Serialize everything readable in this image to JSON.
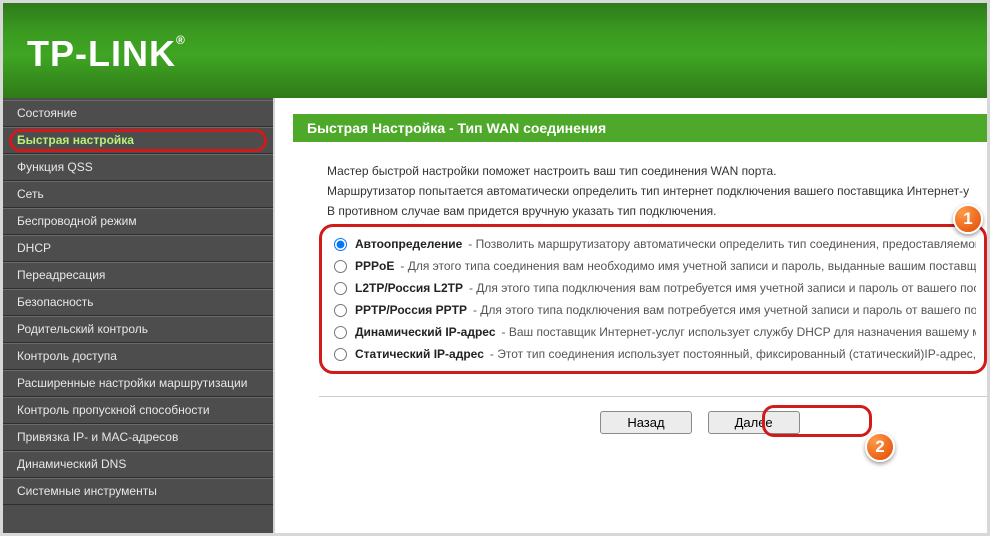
{
  "brand": "TP-LINK",
  "sidebar": {
    "items": [
      {
        "label": "Состояние"
      },
      {
        "label": "Быстрая настройка"
      },
      {
        "label": "Функция QSS"
      },
      {
        "label": "Сеть"
      },
      {
        "label": "Беспроводной режим"
      },
      {
        "label": "DHCP"
      },
      {
        "label": "Переадресация"
      },
      {
        "label": "Безопасность"
      },
      {
        "label": "Родительский контроль"
      },
      {
        "label": "Контроль доступа"
      },
      {
        "label": "Расширенные настройки маршрутизации"
      },
      {
        "label": "Контроль пропускной способности"
      },
      {
        "label": "Привязка IP- и MAC-адресов"
      },
      {
        "label": "Динамический DNS"
      },
      {
        "label": "Системные инструменты"
      }
    ]
  },
  "page": {
    "title": "Быстрая Настройка - Тип WAN соединения",
    "intro1": "Мастер быстрой настройки поможет настроить ваш тип соединения WAN порта.",
    "intro2": "Маршрутизатор попытается автоматически определить тип интернет подключения вашего поставщика Интернет-у",
    "intro3": "В противном случае вам придется вручную указать тип подключения.",
    "options": [
      {
        "label": "Автоопределение",
        "desc": " - Позволить маршрутизатору автоматически определить тип соединения, предоставляемого",
        "checked": true
      },
      {
        "label": "PPPoE",
        "desc": " - Для этого типа соединения вам необходимо имя учетной записи и пароль, выданные вашим поставщико",
        "checked": false
      },
      {
        "label": "L2TP/Россия L2TP",
        "desc": " - Для этого типа подключения вам потребуется имя учетной записи и пароль от вашего постав",
        "checked": false
      },
      {
        "label": "PPTP/Россия PPTP",
        "desc": " - Для этого типа подключения вам потребуется имя учетной записи и пароль от вашего поста",
        "checked": false
      },
      {
        "label": "Динамический IP-адрес",
        "desc": " - Ваш поставщик Интернет-услуг использует службу DHCP для назначения вашему мар",
        "checked": false
      },
      {
        "label": "Статический IP-адрес",
        "desc": " - Этот тип соединения использует постоянный, фиксированный (статический)IP-адрес, на",
        "checked": false
      }
    ],
    "back": "Назад",
    "next": "Далее",
    "badge1": "1",
    "badge2": "2"
  }
}
